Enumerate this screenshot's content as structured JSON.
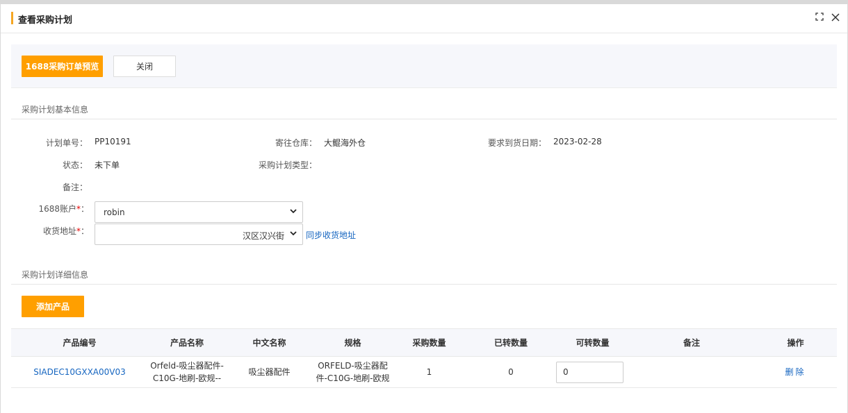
{
  "dialog": {
    "title": "查看采购计划",
    "maximize_icon": "⛶",
    "close_icon": "✕"
  },
  "toolbar": {
    "preview_label": "1688采购订单预览",
    "close_label": "关闭"
  },
  "basic_info": {
    "section_title": "采购计划基本信息",
    "plan_no_label": "计划单号：",
    "plan_no": "PP10191",
    "warehouse_label": "寄往仓库：",
    "warehouse": "大鲲海外仓",
    "due_date_label": "要求到货日期：",
    "due_date": "2023-02-28",
    "status_label": "状态：",
    "status": "未下单",
    "plan_type_label": "采购计划类型：",
    "plan_type": "",
    "remark_label": "备注：",
    "remark": "",
    "account_label": "1688账户",
    "account_suffix": "：",
    "account_value": "robin",
    "address_label": "收货地址",
    "address_suffix": "：",
    "address_value": "汉区汉兴街",
    "sync_address_label": "同步收货地址",
    "required_mark": "*"
  },
  "detail": {
    "section_title": "采购计划详细信息",
    "add_product_label": "添加产品",
    "columns": [
      "产品编号",
      "产品名称",
      "中文名称",
      "规格",
      "采购数量",
      "已转数量",
      "可转数量",
      "备注",
      "操作"
    ],
    "rows": [
      {
        "code": "SIADEC10GXXA00V03",
        "name_line1": "Orfeld-吸尘器配件-",
        "name_line2": "C10G-地刷-欧规--",
        "cn_name": "吸尘器配件",
        "spec_line1": "ORFELD-吸尘器配",
        "spec_line2": "件-C10G-地刷-欧规",
        "purchase_qty": "1",
        "converted_qty": "0",
        "convertible_qty": "0",
        "remark": "",
        "action": "删除"
      }
    ]
  }
}
